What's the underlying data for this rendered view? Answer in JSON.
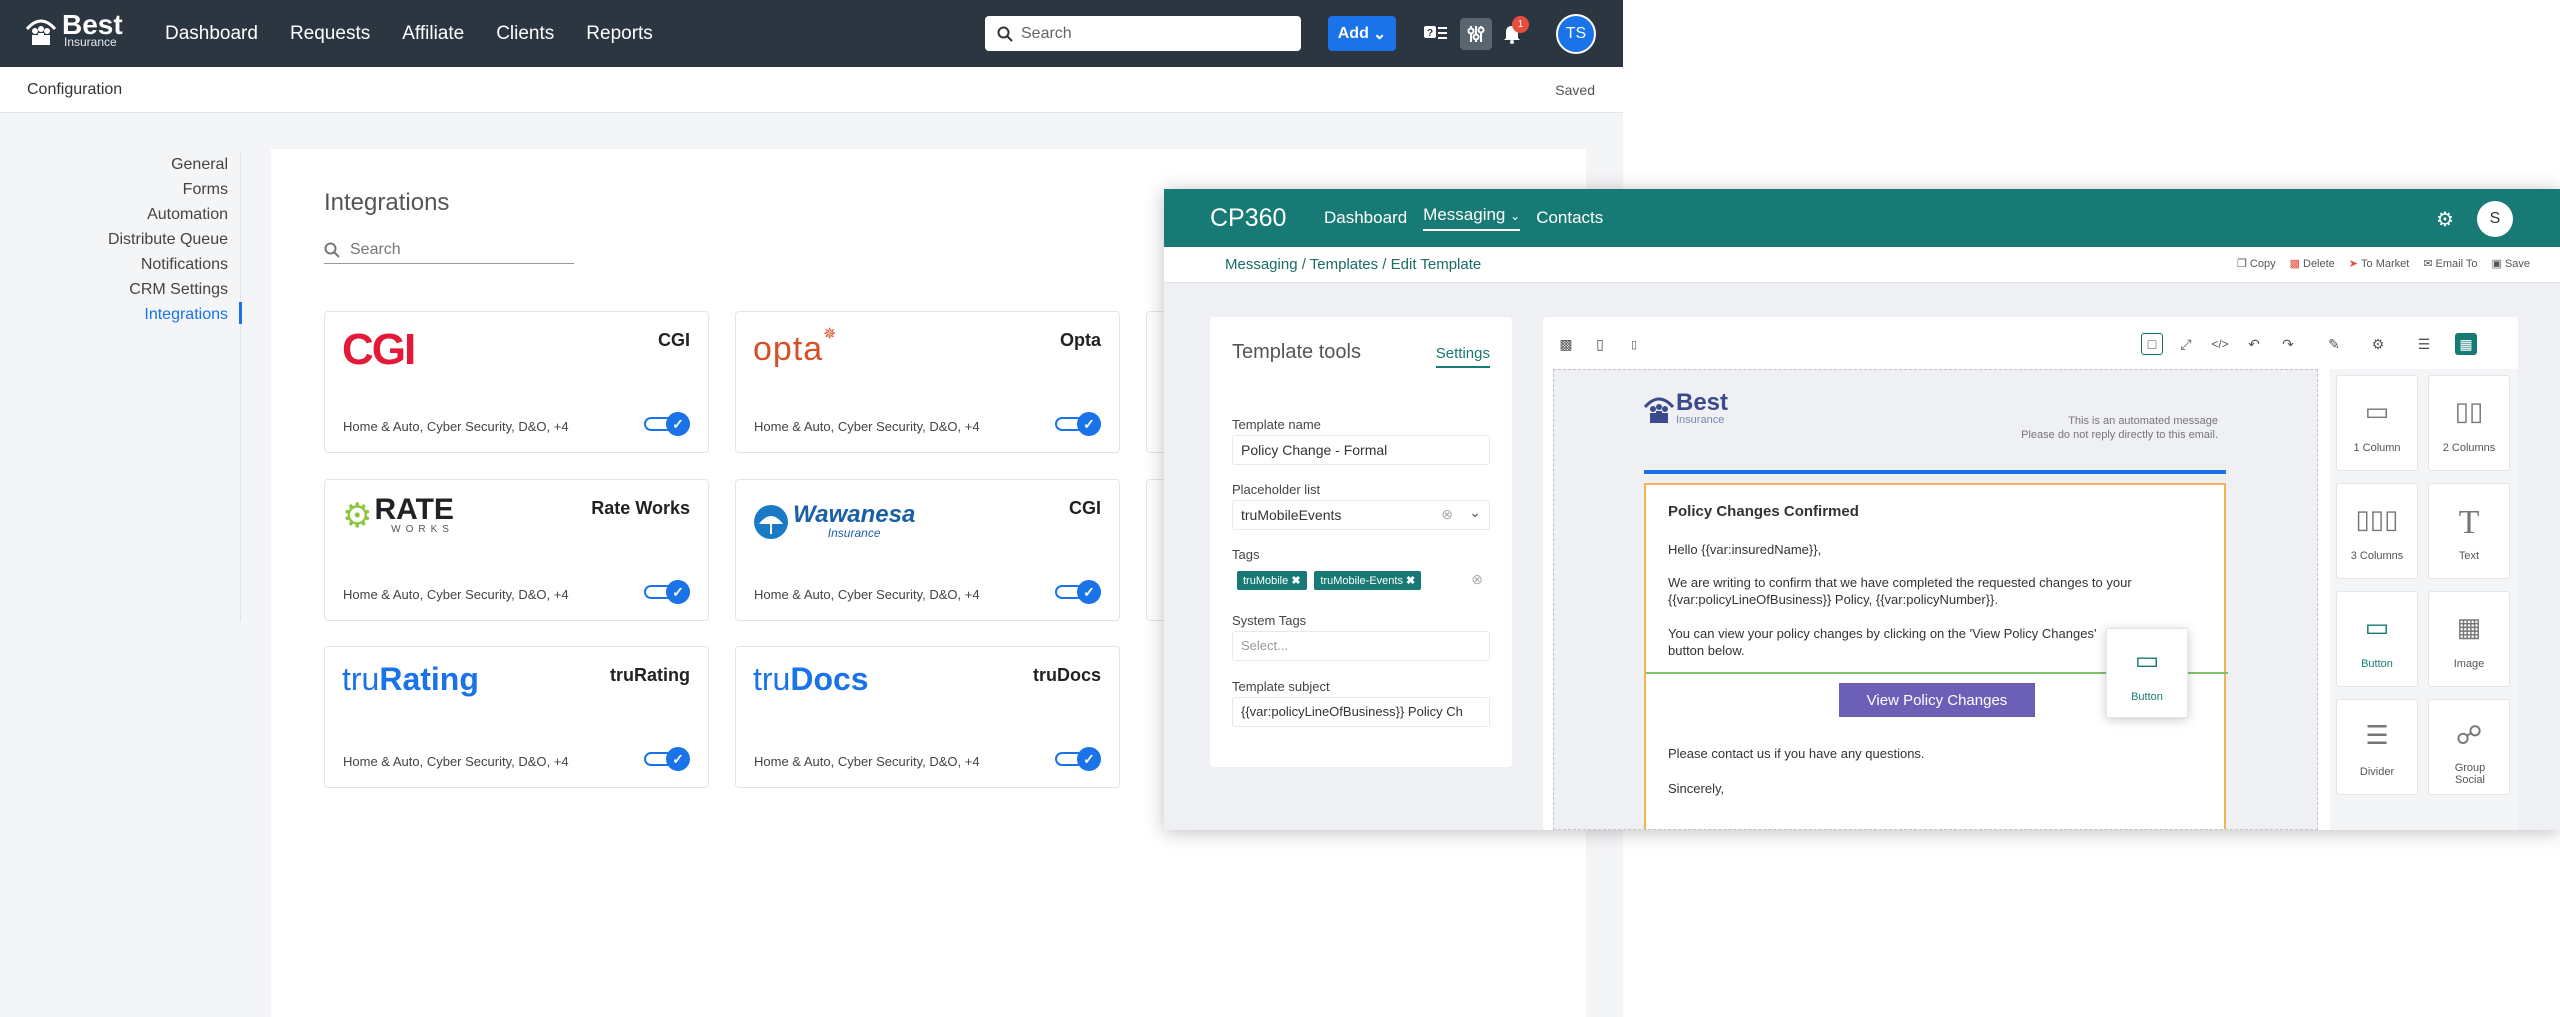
{
  "app": {
    "logo_brand": "Best",
    "logo_sub": "Insurance",
    "nav": [
      "Dashboard",
      "Requests",
      "Affiliate",
      "Clients",
      "Reports"
    ],
    "search_placeholder": "Search",
    "add_label": "Add",
    "notification_count": "1",
    "avatar_initials": "TS"
  },
  "subbar": {
    "title": "Configuration",
    "status": "Saved"
  },
  "sidenav": [
    "General",
    "Forms",
    "Automation",
    "Distribute Queue",
    "Notifications",
    "CRM Settings",
    "Integrations"
  ],
  "integrations": {
    "title": "Integrations",
    "search_placeholder": "Search",
    "cards": [
      {
        "name": "CGI",
        "desc": "Home & Auto, Cyber Security,  D&O, +4",
        "logo": "CGI",
        "enabled": true
      },
      {
        "name": "Opta",
        "desc": "Home & Auto, Cyber Security,  D&O, +4",
        "logo": "opta",
        "enabled": true
      },
      {
        "name": "Rate Works",
        "desc": "Home & Auto, Cyber Security,  D&O, +4",
        "logo": "RATE",
        "logo_sub": "WORKS",
        "enabled": true
      },
      {
        "name": "CGI",
        "desc": "Home & Auto, Cyber Security,  D&O, +4",
        "logo": "Wawanesa",
        "logo_sub": "Insurance",
        "enabled": true
      },
      {
        "name": "truRating",
        "desc": "Home & Auto, Cyber Security,  D&O, +4",
        "logo_a": "tru",
        "logo_b": "Rating",
        "enabled": true
      },
      {
        "name": "truDocs",
        "desc": "Home & Auto, Cyber Security,  D&O, +4",
        "logo_a": "tru",
        "logo_b": "Docs",
        "enabled": true
      }
    ]
  },
  "cp": {
    "logo": "CP360",
    "nav": [
      "Dashboard",
      "Messaging",
      "Contacts"
    ],
    "avatar": "S",
    "breadcrumb": "Messaging / Templates / Edit Template",
    "actions": [
      "Copy",
      "Delete",
      "To Market",
      "Email To",
      "Save"
    ],
    "tools": {
      "title": "Template tools",
      "settings_tab": "Settings",
      "template_name_label": "Template name",
      "template_name": "Policy Change - Formal",
      "placeholder_label": "Placeholder list",
      "placeholder_value": "truMobileEvents",
      "tags_label": "Tags",
      "tags": [
        "truMobile",
        "truMobile-Events"
      ],
      "system_tags_label": "System Tags",
      "system_tags_placeholder": "Select...",
      "subject_label": "Template subject",
      "subject_value": "{{var:policyLineOfBusiness}} Policy Ch"
    },
    "email": {
      "brand": "Best",
      "brand_sub": "Insurance",
      "automated_1": "This is an automated message",
      "automated_2": "Please do not reply directly to this email.",
      "heading": "Policy Changes Confirmed",
      "greeting": "Hello {{var:insuredName}},",
      "para1": "We are writing to confirm that we have completed the requested changes to your {{var:policyLineOfBusiness}} Policy, {{var:policyNumber}}.",
      "para2": "You can view your policy changes by clicking on the 'View Policy Changes' button below.",
      "button": "View Policy Changes",
      "para3": "Please contact us if you have any questions.",
      "closing": "Sincerely,"
    },
    "blocks": [
      "1 Column",
      "2 Columns",
      "3 Columns",
      "Text",
      "Button",
      "Image",
      "Divider",
      "Group Social"
    ],
    "drag_block": "Button"
  }
}
